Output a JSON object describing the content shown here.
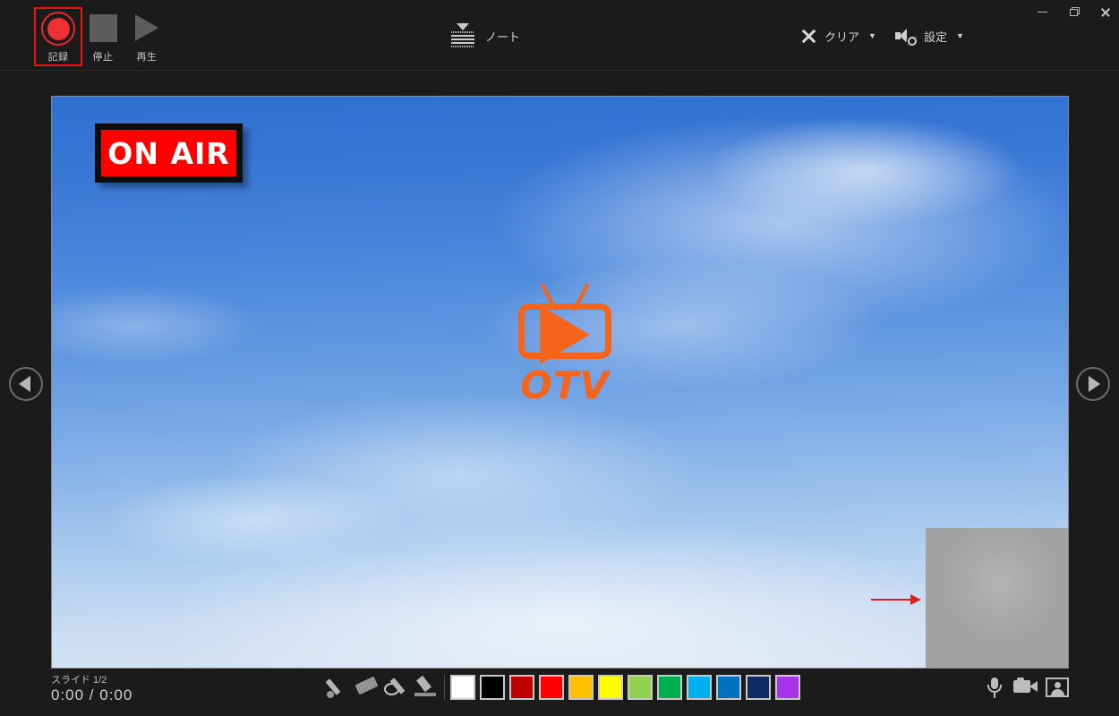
{
  "window": {
    "controls": [
      {
        "name": "minimize",
        "glyph": "minimize-icon"
      },
      {
        "name": "restore",
        "glyph": "restore-icon"
      },
      {
        "name": "close",
        "glyph": "close-icon"
      }
    ]
  },
  "toolbar": {
    "record_label": "記録",
    "stop_label": "停止",
    "play_label": "再生",
    "notes_label": "ノート",
    "clear_label": "クリア",
    "settings_label": "設定",
    "caret": "▼",
    "record_active": true,
    "record_outline_color": "#ee1111"
  },
  "slide": {
    "onair_text": "ON AIR",
    "onair_bg": "#ff0000",
    "onair_border": "#0d0d0d",
    "onair_text_color": "#ffffff",
    "logo_text": "OTV",
    "logo_color": "#f4641b",
    "sky_top_color": "#2f6fd0",
    "sky_bottom_color": "#d9e6f3",
    "arrow_color": "#e02020",
    "webcam_placeholder_color": "#a8a8a8"
  },
  "navigation": {
    "prev_label": "previous-slide",
    "next_label": "next-slide"
  },
  "status": {
    "slide_counter": "スライド 1/2",
    "time": "0:00 / 0:00"
  },
  "ink": {
    "tools": [
      {
        "name": "laser-pointer",
        "label": "laser-pointer-tool"
      },
      {
        "name": "eraser",
        "label": "eraser-tool"
      },
      {
        "name": "erase-all-ink",
        "label": "erase-all-ink-tool"
      },
      {
        "name": "highlighter",
        "label": "highlighter-tool"
      }
    ],
    "colors": [
      {
        "name": "white",
        "hex": "#ffffff"
      },
      {
        "name": "black",
        "hex": "#000000"
      },
      {
        "name": "dark-red",
        "hex": "#c00000"
      },
      {
        "name": "red",
        "hex": "#ff0000"
      },
      {
        "name": "amber",
        "hex": "#ffc000"
      },
      {
        "name": "yellow",
        "hex": "#ffff00"
      },
      {
        "name": "light-green",
        "hex": "#92d050"
      },
      {
        "name": "green",
        "hex": "#00b050"
      },
      {
        "name": "cyan",
        "hex": "#00b0f0"
      },
      {
        "name": "blue",
        "hex": "#0070c0"
      },
      {
        "name": "navy",
        "hex": "#102a63"
      },
      {
        "name": "purple",
        "hex": "#a833e8"
      }
    ]
  },
  "media": {
    "mic_label": "microphone-toggle",
    "camera_label": "camera-toggle",
    "preview_label": "camera-preview-toggle"
  }
}
